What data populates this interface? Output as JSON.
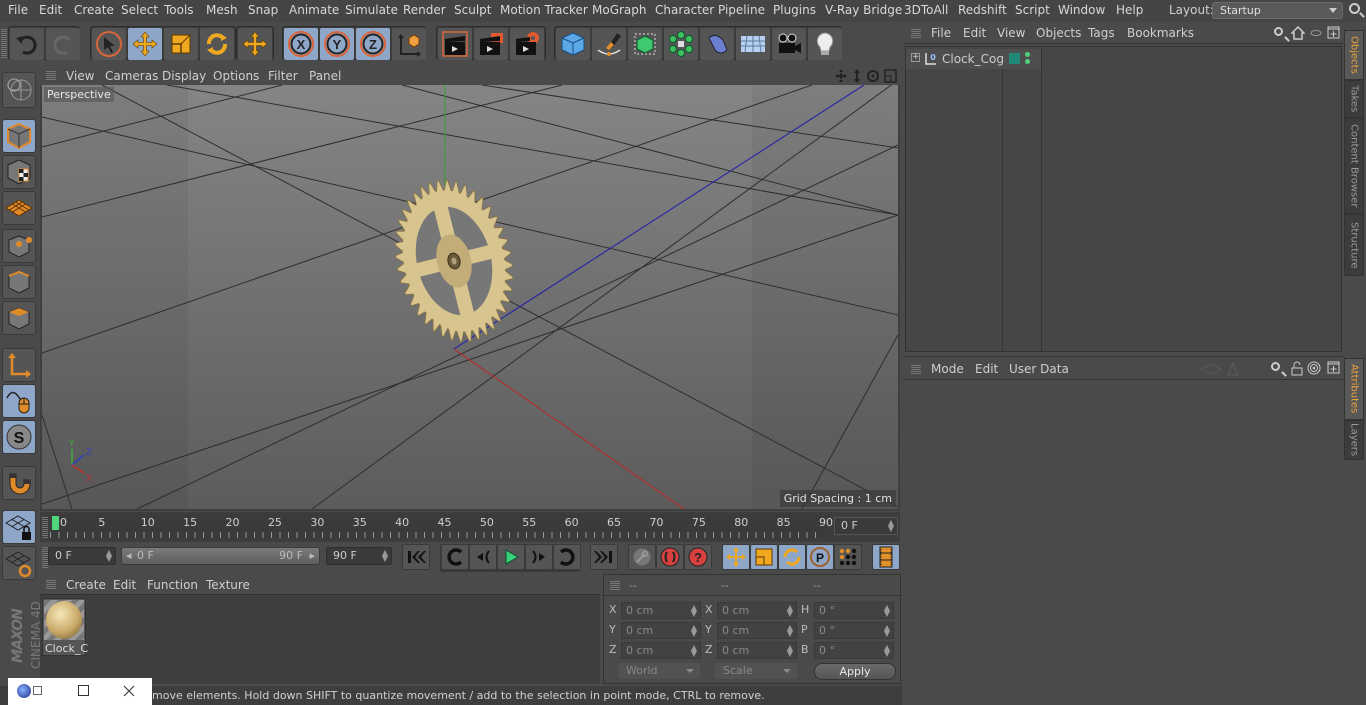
{
  "menubar": {
    "items": [
      "File",
      "Edit",
      "Create",
      "Select",
      "Tools",
      "Mesh",
      "Snap",
      "Animate",
      "Simulate",
      "Render",
      "Sculpt",
      "Motion Tracker",
      "MoGraph",
      "Character",
      "Pipeline",
      "Plugins",
      "V-Ray Bridge",
      "3DToAll",
      "Redshift",
      "Script",
      "Window",
      "Help"
    ],
    "layout_label": "Layout:",
    "layout_value": "Startup"
  },
  "toolbar": {
    "icons": [
      "undo-icon",
      "redo-icon",
      "live-selection-icon",
      "move-icon",
      "scale-icon",
      "rotate-icon",
      "move-tool-icon",
      "x-axis-lock-icon",
      "y-axis-lock-icon",
      "z-axis-lock-icon",
      "coordinate-system-icon",
      "render-view-icon",
      "render-picture-viewer-icon",
      "render-settings-icon",
      "cube-icon",
      "pen-icon",
      "subdivision-icon",
      "cloner-icon",
      "deformer-icon",
      "floor-icon",
      "camera-icon",
      "light-icon"
    ]
  },
  "left_tools": [
    "make-editable-icon",
    "model-mode-icon",
    "texture-mode-icon",
    "workplane-icon",
    "points-mode-icon",
    "edges-mode-icon",
    "polygons-mode-icon",
    "axis-icon",
    "tweak-icon",
    "solo-icon",
    "snap-magnet-icon",
    "workplane-lock-icon",
    "workplane-align-icon"
  ],
  "viewport": {
    "menu": [
      "View",
      "Cameras",
      "Display",
      "Options",
      "Filter",
      "Panel"
    ],
    "camera_label": "Perspective",
    "grid_spacing": "Grid Spacing : 1 cm",
    "axis_labels": {
      "x": "X",
      "y": "Y",
      "z": "Z"
    },
    "colors": {
      "x_axis": "#b03030",
      "y_axis": "#30a030",
      "z_axis": "#2a2aa0",
      "gear": "#d8c48e"
    }
  },
  "timeline": {
    "ticks": [
      "0",
      "5",
      "10",
      "15",
      "20",
      "25",
      "30",
      "35",
      "40",
      "45",
      "50",
      "55",
      "60",
      "65",
      "70",
      "75",
      "80",
      "85",
      "90"
    ],
    "current_frame": "0 F",
    "current_color": "#4fd57a"
  },
  "transport": {
    "start_field": "0 F",
    "range_start": "0 F",
    "range_end": "90 F",
    "end_field": "90 F"
  },
  "material_manager": {
    "menu": [
      "Create",
      "Edit",
      "Function",
      "Texture"
    ],
    "materials": [
      {
        "name": "Clock_C"
      }
    ]
  },
  "coordinates": {
    "headers": [
      "--",
      "--",
      "--"
    ],
    "rows": [
      {
        "l1": "X",
        "v1": "0 cm",
        "l2": "X",
        "v2": "0 cm",
        "l3": "H",
        "v3": "0 °"
      },
      {
        "l1": "Y",
        "v1": "0 cm",
        "l2": "Y",
        "v2": "0 cm",
        "l3": "P",
        "v3": "0 °"
      },
      {
        "l1": "Z",
        "v1": "0 cm",
        "l2": "Z",
        "v2": "0 cm",
        "l3": "B",
        "v3": "0 °"
      }
    ],
    "space_select": "World",
    "mode_select": "Scale",
    "apply_label": "Apply"
  },
  "status": {
    "text": "move elements. Hold down SHIFT to quantize movement / add to the selection in point mode, CTRL to remove."
  },
  "object_manager": {
    "menu": [
      "File",
      "Edit",
      "View",
      "Objects",
      "Tags",
      "Bookmarks"
    ],
    "objects": [
      {
        "name": "Clock_Cog",
        "layer_icon": "null-object-icon"
      }
    ],
    "tag_color": "#1f8a78"
  },
  "attribute_manager": {
    "menu": [
      "Mode",
      "Edit",
      "User Data"
    ]
  },
  "right_tabs": {
    "top": [
      "Objects",
      "Takes",
      "Content Browser",
      "Structure"
    ],
    "bottom": [
      "Attributes",
      "Layers"
    ]
  },
  "branding": {
    "text1": "MAXON",
    "text2": "CINEMA 4D"
  }
}
